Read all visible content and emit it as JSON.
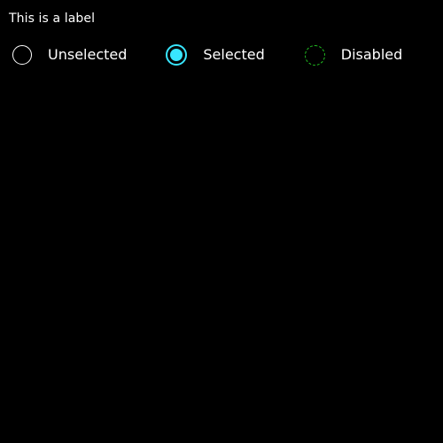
{
  "group": {
    "label": "This is a label"
  },
  "options": [
    {
      "label": "Unselected",
      "state": "unselected"
    },
    {
      "label": "Selected",
      "state": "selected"
    },
    {
      "label": "Disabled",
      "state": "disabled"
    }
  ],
  "colors": {
    "background": "#000000",
    "text": "#ffffff",
    "selected_accent": "#38e6ff",
    "disabled_outline": "#22c422",
    "unselected_outline": "#ffffff"
  }
}
